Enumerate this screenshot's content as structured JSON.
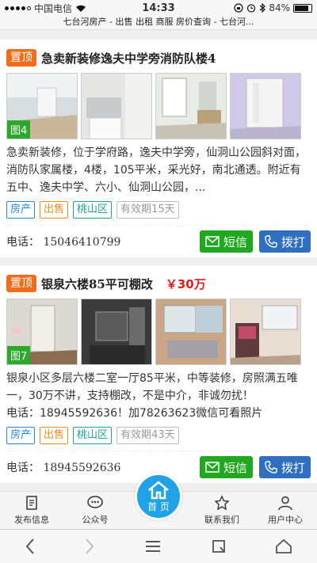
{
  "status": {
    "carrier": "中国电信",
    "time": "14:33",
    "battery": "84%",
    "battery_level": 0.84
  },
  "url_title": "七台河房产 - 出售 出租 商服 房价查询 - 七台河...",
  "listings": [
    {
      "pin": "置顶",
      "title": "急卖新装修逸夫中学旁消防队楼4",
      "price": "",
      "photo_count": "图4",
      "description": "急卖新装修，位于学府路，逸夫中学旁，仙洞山公园斜对面，消防队家属楼，4楼，105平米，采光好，南北通透。附近有五中、逸夫中学、六小、仙洞山公园，...",
      "tags": [
        "房产",
        "出售",
        "桃山区",
        "有效期15天"
      ],
      "phone_line": "",
      "contact": "电话： 15046410799"
    },
    {
      "pin": "置顶",
      "title": "银泉六楼85平可棚改",
      "price": "￥30万",
      "photo_count": "图7",
      "description": "银泉小区多层六楼二室一厅85平米，中等装修，房照满五唯一，30万不讲，支持棚改，不是中介，非诚勿扰！",
      "phone_line": "电话：18945592636！加78263623微信可看照片",
      "tags": [
        "房产",
        "出售",
        "桃山区",
        "有效期43天"
      ],
      "contact": "电话： 18945592636"
    }
  ],
  "buttons": {
    "sms": "短信",
    "call": "拨打"
  },
  "nav": {
    "publish": "发布信息",
    "public_account": "公众号",
    "home": "首 页",
    "contact_us": "联系我们",
    "user_center": "用户中心"
  },
  "colors": {
    "pin": "#f16c1b",
    "sms": "#20a820",
    "call": "#2f6fbf",
    "home": "#1fa2e6",
    "price": "#e01c1c"
  }
}
